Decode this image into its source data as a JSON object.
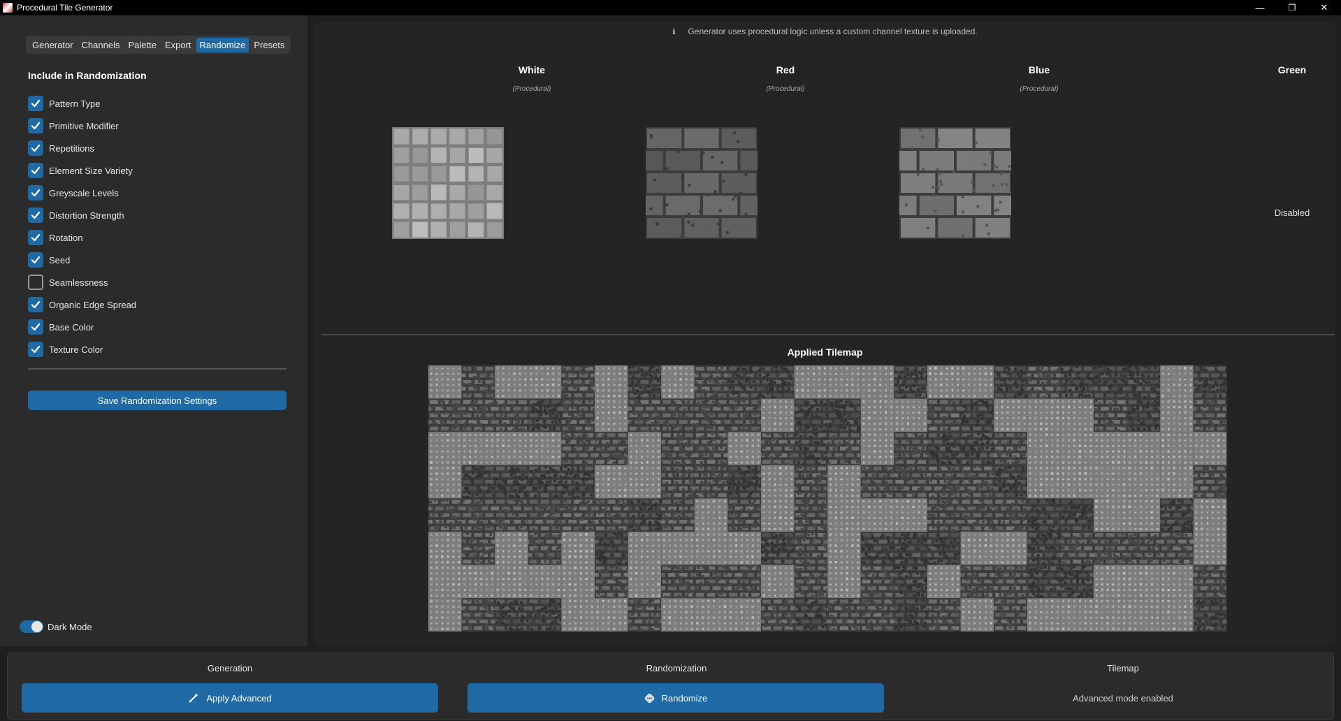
{
  "window": {
    "title": "Procedural Tile Generator",
    "minimize": "—",
    "restore": "❐",
    "close": "✕"
  },
  "tabs": [
    "Generator",
    "Channels",
    "Palette",
    "Export",
    "Randomize",
    "Presets"
  ],
  "active_tab": "Randomize",
  "randomization": {
    "title": "Include in Randomization",
    "options": [
      {
        "label": "Pattern Type",
        "checked": true
      },
      {
        "label": "Primitive Modifier",
        "checked": true
      },
      {
        "label": "Repetitions",
        "checked": true
      },
      {
        "label": "Element Size Variety",
        "checked": true
      },
      {
        "label": "Greyscale Levels",
        "checked": true
      },
      {
        "label": "Distortion Strength",
        "checked": true
      },
      {
        "label": "Rotation",
        "checked": true
      },
      {
        "label": "Seed",
        "checked": true
      },
      {
        "label": "Seamlessness",
        "checked": false
      },
      {
        "label": "Organic Edge Spread",
        "checked": true
      },
      {
        "label": "Base Color",
        "checked": true
      },
      {
        "label": "Texture Color",
        "checked": true
      }
    ],
    "save_label": "Save Randomization Settings"
  },
  "dark_mode": {
    "label": "Dark Mode",
    "enabled": true
  },
  "info": {
    "icon": "ℹ",
    "text": "Generator uses procedural logic unless a custom channel texture is uploaded."
  },
  "channels": [
    {
      "name": "White",
      "subtitle": "(Procedural)",
      "pattern": "cobble-light"
    },
    {
      "name": "Red",
      "subtitle": "(Procedural)",
      "pattern": "brick-dark"
    },
    {
      "name": "Blue",
      "subtitle": "(Procedural)",
      "pattern": "brick-mid"
    },
    {
      "name": "Green",
      "subtitle": "",
      "status": "Disabled"
    }
  ],
  "tilemap": {
    "title": "Applied Tilemap"
  },
  "bottom": {
    "generation": {
      "title": "Generation",
      "button": "Apply Advanced",
      "icon": "magic-wand-icon"
    },
    "randomization": {
      "title": "Randomization",
      "button": "Randomize",
      "icon": "dice-icon"
    },
    "tilemap": {
      "title": "Tilemap",
      "status": "Advanced mode enabled"
    }
  },
  "colors": {
    "accent": "#1f6aa5",
    "panel": "#2b2b2b",
    "background": "#242424"
  }
}
